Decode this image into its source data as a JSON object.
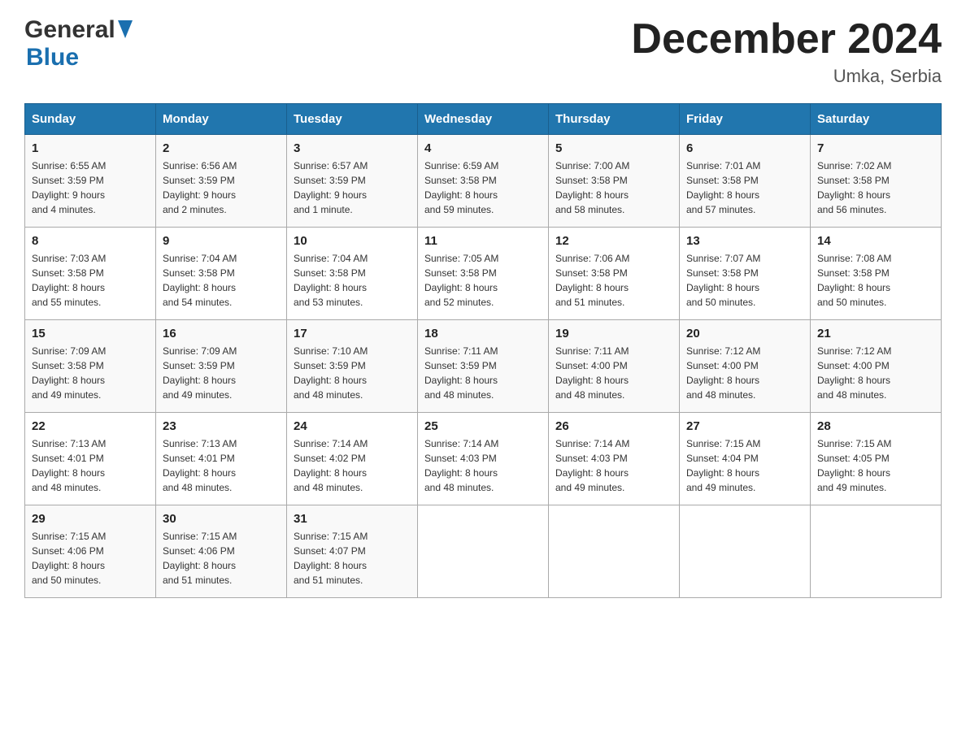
{
  "header": {
    "logo_general": "General",
    "logo_blue": "Blue",
    "title": "December 2024",
    "location": "Umka, Serbia"
  },
  "weekdays": [
    "Sunday",
    "Monday",
    "Tuesday",
    "Wednesday",
    "Thursday",
    "Friday",
    "Saturday"
  ],
  "weeks": [
    [
      {
        "day": "1",
        "sunrise": "Sunrise: 6:55 AM",
        "sunset": "Sunset: 3:59 PM",
        "daylight": "Daylight: 9 hours",
        "daylight2": "and 4 minutes."
      },
      {
        "day": "2",
        "sunrise": "Sunrise: 6:56 AM",
        "sunset": "Sunset: 3:59 PM",
        "daylight": "Daylight: 9 hours",
        "daylight2": "and 2 minutes."
      },
      {
        "day": "3",
        "sunrise": "Sunrise: 6:57 AM",
        "sunset": "Sunset: 3:59 PM",
        "daylight": "Daylight: 9 hours",
        "daylight2": "and 1 minute."
      },
      {
        "day": "4",
        "sunrise": "Sunrise: 6:59 AM",
        "sunset": "Sunset: 3:58 PM",
        "daylight": "Daylight: 8 hours",
        "daylight2": "and 59 minutes."
      },
      {
        "day": "5",
        "sunrise": "Sunrise: 7:00 AM",
        "sunset": "Sunset: 3:58 PM",
        "daylight": "Daylight: 8 hours",
        "daylight2": "and 58 minutes."
      },
      {
        "day": "6",
        "sunrise": "Sunrise: 7:01 AM",
        "sunset": "Sunset: 3:58 PM",
        "daylight": "Daylight: 8 hours",
        "daylight2": "and 57 minutes."
      },
      {
        "day": "7",
        "sunrise": "Sunrise: 7:02 AM",
        "sunset": "Sunset: 3:58 PM",
        "daylight": "Daylight: 8 hours",
        "daylight2": "and 56 minutes."
      }
    ],
    [
      {
        "day": "8",
        "sunrise": "Sunrise: 7:03 AM",
        "sunset": "Sunset: 3:58 PM",
        "daylight": "Daylight: 8 hours",
        "daylight2": "and 55 minutes."
      },
      {
        "day": "9",
        "sunrise": "Sunrise: 7:04 AM",
        "sunset": "Sunset: 3:58 PM",
        "daylight": "Daylight: 8 hours",
        "daylight2": "and 54 minutes."
      },
      {
        "day": "10",
        "sunrise": "Sunrise: 7:04 AM",
        "sunset": "Sunset: 3:58 PM",
        "daylight": "Daylight: 8 hours",
        "daylight2": "and 53 minutes."
      },
      {
        "day": "11",
        "sunrise": "Sunrise: 7:05 AM",
        "sunset": "Sunset: 3:58 PM",
        "daylight": "Daylight: 8 hours",
        "daylight2": "and 52 minutes."
      },
      {
        "day": "12",
        "sunrise": "Sunrise: 7:06 AM",
        "sunset": "Sunset: 3:58 PM",
        "daylight": "Daylight: 8 hours",
        "daylight2": "and 51 minutes."
      },
      {
        "day": "13",
        "sunrise": "Sunrise: 7:07 AM",
        "sunset": "Sunset: 3:58 PM",
        "daylight": "Daylight: 8 hours",
        "daylight2": "and 50 minutes."
      },
      {
        "day": "14",
        "sunrise": "Sunrise: 7:08 AM",
        "sunset": "Sunset: 3:58 PM",
        "daylight": "Daylight: 8 hours",
        "daylight2": "and 50 minutes."
      }
    ],
    [
      {
        "day": "15",
        "sunrise": "Sunrise: 7:09 AM",
        "sunset": "Sunset: 3:58 PM",
        "daylight": "Daylight: 8 hours",
        "daylight2": "and 49 minutes."
      },
      {
        "day": "16",
        "sunrise": "Sunrise: 7:09 AM",
        "sunset": "Sunset: 3:59 PM",
        "daylight": "Daylight: 8 hours",
        "daylight2": "and 49 minutes."
      },
      {
        "day": "17",
        "sunrise": "Sunrise: 7:10 AM",
        "sunset": "Sunset: 3:59 PM",
        "daylight": "Daylight: 8 hours",
        "daylight2": "and 48 minutes."
      },
      {
        "day": "18",
        "sunrise": "Sunrise: 7:11 AM",
        "sunset": "Sunset: 3:59 PM",
        "daylight": "Daylight: 8 hours",
        "daylight2": "and 48 minutes."
      },
      {
        "day": "19",
        "sunrise": "Sunrise: 7:11 AM",
        "sunset": "Sunset: 4:00 PM",
        "daylight": "Daylight: 8 hours",
        "daylight2": "and 48 minutes."
      },
      {
        "day": "20",
        "sunrise": "Sunrise: 7:12 AM",
        "sunset": "Sunset: 4:00 PM",
        "daylight": "Daylight: 8 hours",
        "daylight2": "and 48 minutes."
      },
      {
        "day": "21",
        "sunrise": "Sunrise: 7:12 AM",
        "sunset": "Sunset: 4:00 PM",
        "daylight": "Daylight: 8 hours",
        "daylight2": "and 48 minutes."
      }
    ],
    [
      {
        "day": "22",
        "sunrise": "Sunrise: 7:13 AM",
        "sunset": "Sunset: 4:01 PM",
        "daylight": "Daylight: 8 hours",
        "daylight2": "and 48 minutes."
      },
      {
        "day": "23",
        "sunrise": "Sunrise: 7:13 AM",
        "sunset": "Sunset: 4:01 PM",
        "daylight": "Daylight: 8 hours",
        "daylight2": "and 48 minutes."
      },
      {
        "day": "24",
        "sunrise": "Sunrise: 7:14 AM",
        "sunset": "Sunset: 4:02 PM",
        "daylight": "Daylight: 8 hours",
        "daylight2": "and 48 minutes."
      },
      {
        "day": "25",
        "sunrise": "Sunrise: 7:14 AM",
        "sunset": "Sunset: 4:03 PM",
        "daylight": "Daylight: 8 hours",
        "daylight2": "and 48 minutes."
      },
      {
        "day": "26",
        "sunrise": "Sunrise: 7:14 AM",
        "sunset": "Sunset: 4:03 PM",
        "daylight": "Daylight: 8 hours",
        "daylight2": "and 49 minutes."
      },
      {
        "day": "27",
        "sunrise": "Sunrise: 7:15 AM",
        "sunset": "Sunset: 4:04 PM",
        "daylight": "Daylight: 8 hours",
        "daylight2": "and 49 minutes."
      },
      {
        "day": "28",
        "sunrise": "Sunrise: 7:15 AM",
        "sunset": "Sunset: 4:05 PM",
        "daylight": "Daylight: 8 hours",
        "daylight2": "and 49 minutes."
      }
    ],
    [
      {
        "day": "29",
        "sunrise": "Sunrise: 7:15 AM",
        "sunset": "Sunset: 4:06 PM",
        "daylight": "Daylight: 8 hours",
        "daylight2": "and 50 minutes."
      },
      {
        "day": "30",
        "sunrise": "Sunrise: 7:15 AM",
        "sunset": "Sunset: 4:06 PM",
        "daylight": "Daylight: 8 hours",
        "daylight2": "and 51 minutes."
      },
      {
        "day": "31",
        "sunrise": "Sunrise: 7:15 AM",
        "sunset": "Sunset: 4:07 PM",
        "daylight": "Daylight: 8 hours",
        "daylight2": "and 51 minutes."
      },
      {
        "day": "",
        "sunrise": "",
        "sunset": "",
        "daylight": "",
        "daylight2": ""
      },
      {
        "day": "",
        "sunrise": "",
        "sunset": "",
        "daylight": "",
        "daylight2": ""
      },
      {
        "day": "",
        "sunrise": "",
        "sunset": "",
        "daylight": "",
        "daylight2": ""
      },
      {
        "day": "",
        "sunrise": "",
        "sunset": "",
        "daylight": "",
        "daylight2": ""
      }
    ]
  ]
}
